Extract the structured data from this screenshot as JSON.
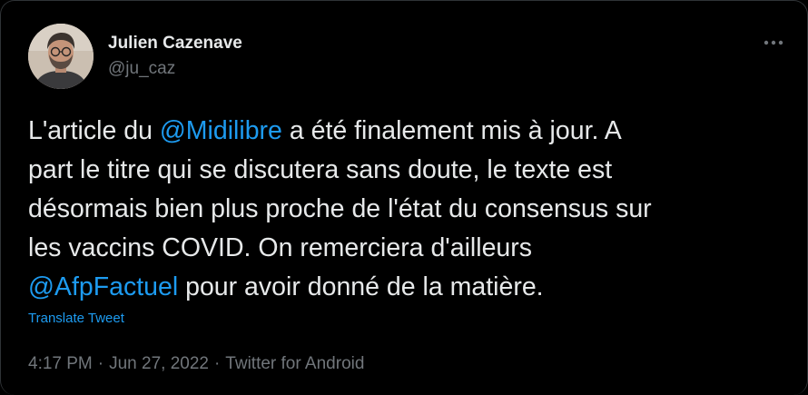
{
  "author": {
    "display_name": "Julien Cazenave",
    "handle": "@ju_caz",
    "avatar_icon": "profile-photo"
  },
  "more_icon": "more-horizontal-icon",
  "tweet": {
    "lines": [
      [
        {
          "text": "L'article du ",
          "type": "text"
        },
        {
          "text": "@Midilibre",
          "type": "mention"
        },
        {
          "text": " a été finalement mis à jour. A",
          "type": "text"
        }
      ],
      [
        {
          "text": "part le titre qui se discutera sans doute, le texte est",
          "type": "text"
        }
      ],
      [
        {
          "text": "désormais bien plus proche de l'état du consensus sur",
          "type": "text"
        }
      ],
      [
        {
          "text": "les vaccins COVID. On remerciera d'ailleurs",
          "type": "text"
        }
      ],
      [
        {
          "text": "@AfpFactuel",
          "type": "mention"
        },
        {
          "text": " pour avoir donné de la matière.",
          "type": "text"
        }
      ]
    ]
  },
  "translate_label": "Translate Tweet",
  "meta": {
    "time": "4:17 PM",
    "separator": "·",
    "date": "Jun 27, 2022",
    "client": "Twitter for Android"
  },
  "colors": {
    "background": "#000000",
    "text": "#e7e9ea",
    "secondary": "#71767b",
    "link": "#1d9bf0"
  }
}
